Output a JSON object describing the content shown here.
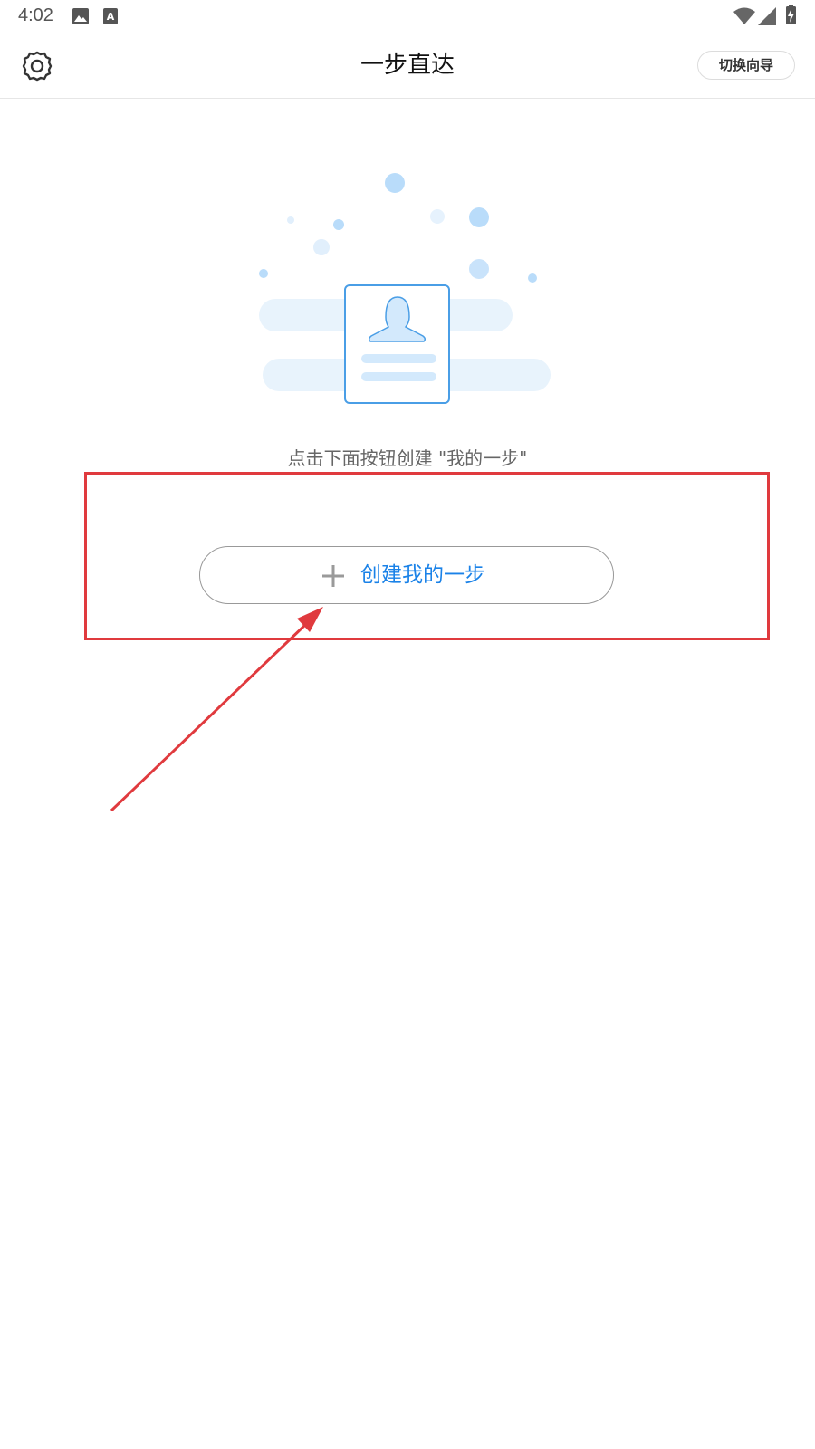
{
  "status_bar": {
    "time": "4:02",
    "icons": [
      "image-icon",
      "text-a-icon",
      "wifi-icon",
      "signal-icon",
      "battery-charging-icon"
    ]
  },
  "app_bar": {
    "title": "一步直达",
    "switch_button_label": "切换向导",
    "settings_icon": "gear-icon"
  },
  "empty_state": {
    "illustration": "id-card-illustration",
    "hint": "点击下面按钮创建 \"我的一步\"",
    "create_button_label": "创建我的一步",
    "create_button_icon": "plus-icon"
  },
  "annotations": {
    "highlight_color": "#e03a3e"
  },
  "colors": {
    "accent": "#1a82e8",
    "illustration_light": "#e8f3fc",
    "illustration_stroke": "#4a9ee6"
  }
}
